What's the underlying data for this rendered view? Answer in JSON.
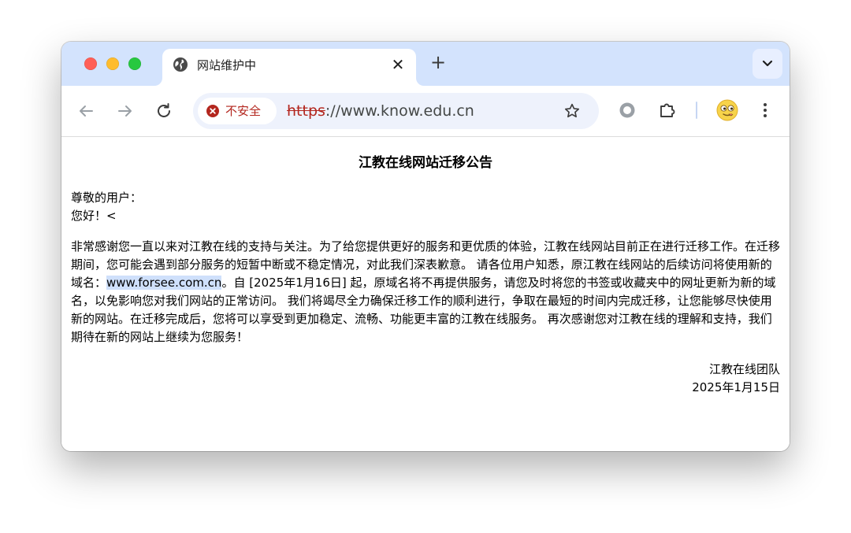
{
  "tab": {
    "title": "网站维护中",
    "close_glyph": "✕",
    "new_tab_glyph": "+"
  },
  "toolbar": {
    "security_label": "不安全",
    "url_scheme": "https",
    "url_rest": "://www.know.edu.cn"
  },
  "page": {
    "title": "江教在线网站迁移公告",
    "salutation": "尊敬的用户：",
    "hello": "您好！<",
    "body_part1": "非常感谢您一直以来对江教在线的支持与关注。为了给您提供更好的服务和更优质的体验，江教在线网站目前正在进行迁移工作。在迁移期间，您可能会遇到部分服务的短暂中断或不稳定情况，对此我们深表歉意。 请各位用户知悉，原江教在线网站的后续访问将使用新的域名：",
    "new_domain": "www.forsee.com.cn",
    "body_part2": "。自 [2025年1月16日] 起，原域名将不再提供服务，请您及时将您的书签或收藏夹中的网址更新为新的域名，以免影响您对我们网站的正常访问。 我们将竭尽全力确保迁移工作的顺利进行，争取在最短的时间内完成迁移，让您能够尽快使用新的网站。在迁移完成后，您将可以享受到更加稳定、流畅、功能更丰富的江教在线服务。 再次感谢您对江教在线的理解和支持，我们期待在新的网站上继续为您服务！",
    "signature_team": "江教在线团队",
    "signature_date": "2025年1月15日"
  },
  "icons": {
    "tab_favicon": "globe-icon",
    "security": "warning-circle-icon",
    "bookmark": "star-icon",
    "extensions": "puzzle-icon",
    "profile": "emoji-avatar-icon",
    "menu": "kebab-menu-icon"
  },
  "colors": {
    "tabstrip": "#d3e3fd",
    "omnibox": "#eef2fc",
    "insecure": "#b3261e",
    "selection_highlight": "#cfe0fb"
  }
}
